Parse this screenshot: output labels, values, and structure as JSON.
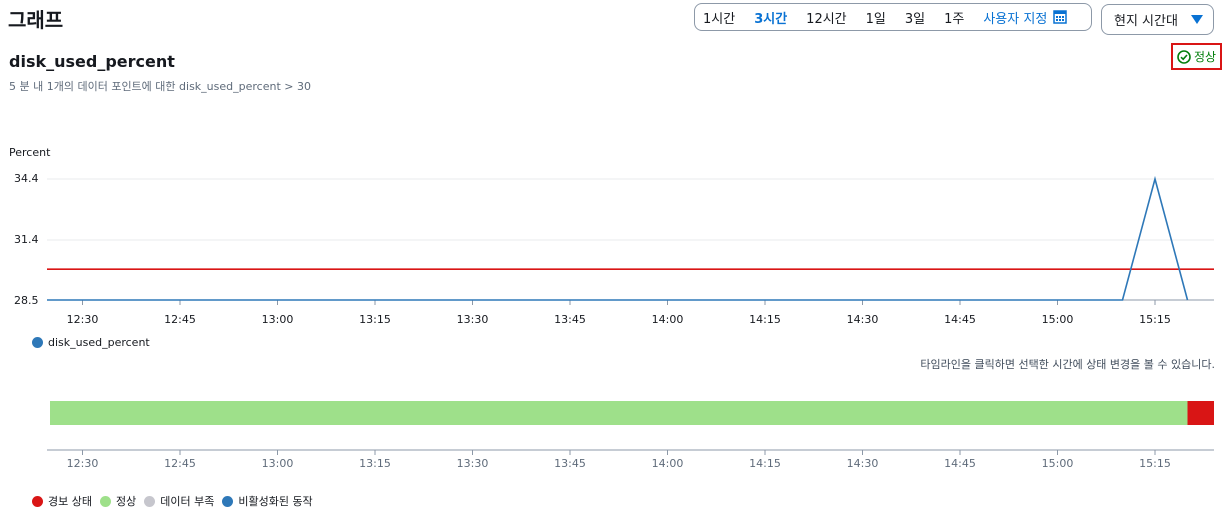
{
  "header": {
    "title": "그래프",
    "time_ranges": [
      {
        "label": "1시간",
        "active": false
      },
      {
        "label": "3시간",
        "active": true
      },
      {
        "label": "12시간",
        "active": false
      },
      {
        "label": "1일",
        "active": false
      },
      {
        "label": "3일",
        "active": false
      },
      {
        "label": "1주",
        "active": false
      }
    ],
    "custom_label": "사용자 지정",
    "timezone_label": "현지 시간대"
  },
  "alarm": {
    "metric_name": "disk_used_percent",
    "condition_text": "5 분 내 1개의 데이터 포인트에 대한 disk_used_percent > 30",
    "status_label": "정상",
    "status_color": "#037f0c"
  },
  "chart_data": {
    "type": "line",
    "ylabel": "Percent",
    "ytick_labels": [
      "34.4",
      "31.4",
      "28.5"
    ],
    "ylim": [
      28.5,
      34.4
    ],
    "xtick_labels": [
      "12:30",
      "12:45",
      "13:00",
      "13:15",
      "13:30",
      "13:45",
      "14:00",
      "14:15",
      "14:30",
      "14:45",
      "15:00",
      "15:15"
    ],
    "threshold": 30,
    "threshold_color": "#d91515",
    "series": [
      {
        "name": "disk_used_percent",
        "color": "#2e78b8",
        "x": [
          "12:25",
          "15:10",
          "15:15",
          "15:20"
        ],
        "y": [
          28.5,
          28.5,
          34.4,
          28.5
        ]
      }
    ]
  },
  "timeline": {
    "hint": "타임라인을 클릭하면 선택한 시간에 상태 변경을 볼 수 있습니다.",
    "segments": [
      {
        "state": "정상",
        "color": "#9ee08a",
        "from": "12:25",
        "to": "15:20"
      },
      {
        "state": "경보 상태",
        "color": "#d91515",
        "from": "15:20",
        "to": "15:25"
      }
    ],
    "xtick_labels": [
      "12:30",
      "12:45",
      "13:00",
      "13:15",
      "13:30",
      "13:45",
      "14:00",
      "14:15",
      "14:30",
      "14:45",
      "15:00",
      "15:15"
    ],
    "legend": [
      {
        "label": "경보 상태",
        "color": "#d91515"
      },
      {
        "label": "정상",
        "color": "#9ee08a"
      },
      {
        "label": "데이터 부족",
        "color": "#c6c6cd"
      },
      {
        "label": "비활성화된 동작",
        "color": "#2e78b8"
      }
    ]
  }
}
